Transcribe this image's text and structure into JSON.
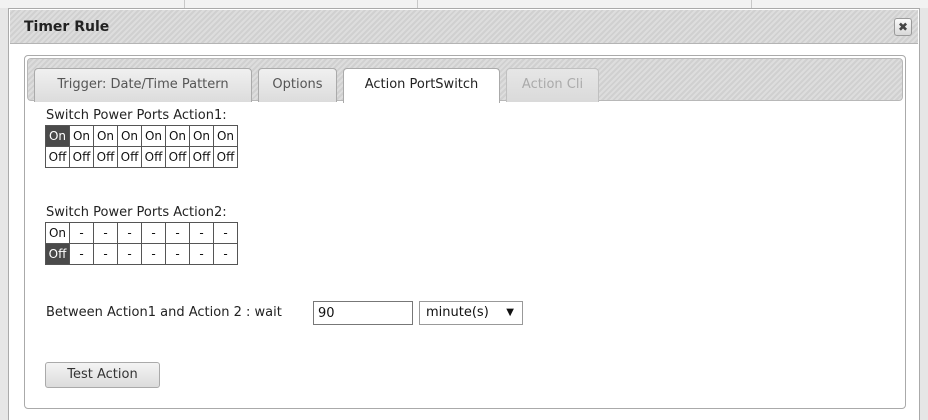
{
  "dialog": {
    "title": "Timer Rule",
    "close_icon": "close-icon"
  },
  "tabs": [
    {
      "label": "Trigger: Date/Time Pattern",
      "state": "inactive"
    },
    {
      "label": "Options",
      "state": "inactive"
    },
    {
      "label": "Action PortSwitch",
      "state": "active"
    },
    {
      "label": "Action Cli",
      "state": "disabled"
    }
  ],
  "action1": {
    "label": "Switch Power Ports Action1:",
    "on_row": [
      "On",
      "On",
      "On",
      "On",
      "On",
      "On",
      "On",
      "On"
    ],
    "off_row": [
      "Off",
      "Off",
      "Off",
      "Off",
      "Off",
      "Off",
      "Off",
      "Off"
    ],
    "selected": "port 1 On"
  },
  "action2": {
    "label": "Switch Power Ports Action2:",
    "on_row": [
      "On",
      "-",
      "-",
      "-",
      "-",
      "-",
      "-",
      "-"
    ],
    "off_row": [
      "Off",
      "-",
      "-",
      "-",
      "-",
      "-",
      "-",
      "-"
    ],
    "selected": "port 1 Off"
  },
  "wait": {
    "label": "Between Action1 and Action 2 : wait",
    "value": "90",
    "unit": "minute(s)",
    "unit_icon": "chevron-down-icon"
  },
  "test_button": {
    "label": "Test Action"
  },
  "colors": {
    "selected_cell": "#4a4a4a",
    "titlebar": "#d6d6d6"
  }
}
